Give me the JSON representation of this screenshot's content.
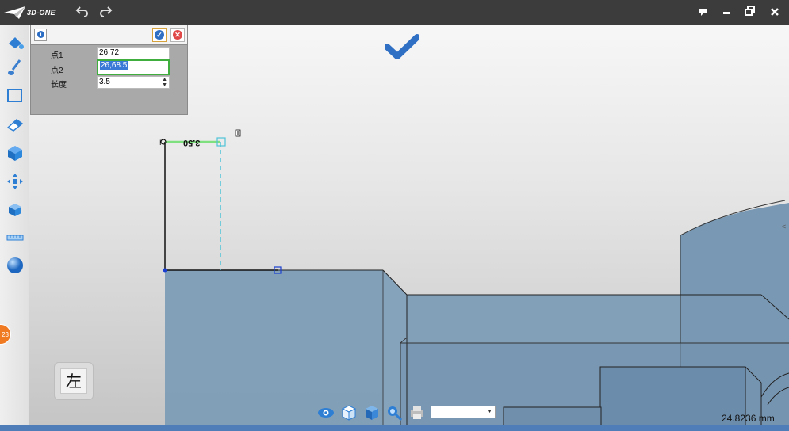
{
  "app": {
    "name": "3D-ONE"
  },
  "panel": {
    "rows": [
      {
        "label": "点1",
        "value": "26,72"
      },
      {
        "label": "点2",
        "value": "26,68.5"
      },
      {
        "label": "长度",
        "value": "3.5"
      }
    ]
  },
  "canvas": {
    "dimension_text": "3.50"
  },
  "view": {
    "label": "左",
    "badge": "23"
  },
  "status": {
    "measure": "24.8236 mm"
  },
  "colors": {
    "accent": "#2f6fc4",
    "model_fill": "#7d9bb5",
    "ok_green": "#3fae3f",
    "cancel_red": "#e04848"
  }
}
